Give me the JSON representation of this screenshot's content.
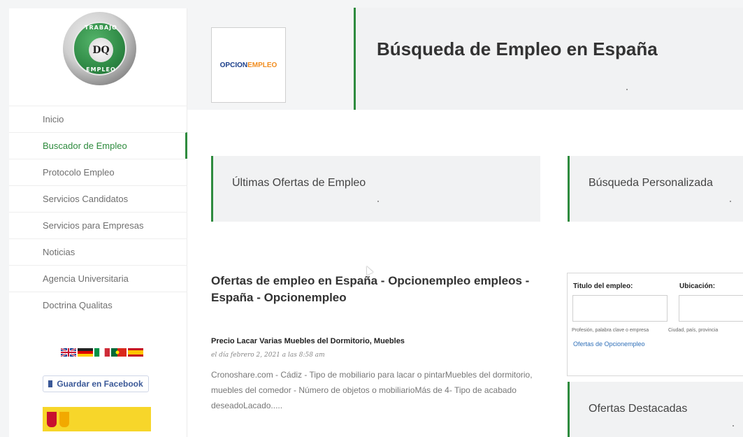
{
  "sidebar": {
    "logo": {
      "top_text": "TRABAJO",
      "center_text": "DQ",
      "bottom_text": "EMPLEO"
    },
    "items": [
      {
        "label": "Inicio"
      },
      {
        "label": "Buscador de Empleo"
      },
      {
        "label": "Protocolo Empleo"
      },
      {
        "label": "Servicios Candidatos"
      },
      {
        "label": "Servicios para Empresas"
      },
      {
        "label": "Noticias"
      },
      {
        "label": "Agencia Universitaria"
      },
      {
        "label": "Doctrina Qualitas"
      }
    ],
    "active_index": 1,
    "language_flags": [
      "uk-flag-icon",
      "germany-flag-icon",
      "italy-flag-icon",
      "portugal-flag-icon",
      "spain-flag-icon"
    ],
    "facebook_button": {
      "label": "Guardar en Facebook",
      "icon": "bookmark-icon"
    }
  },
  "header": {
    "brand_logo": {
      "part1": "OPCION",
      "part2": "EMPLEO"
    },
    "title": "Búsqueda de Empleo en España"
  },
  "sections": {
    "latest": {
      "title": "Últimas Ofertas de Empleo"
    },
    "custom_search": {
      "title": "Búsqueda Personalizada"
    },
    "featured": {
      "title": "Ofertas Destacadas"
    }
  },
  "listing": {
    "heading": "Ofertas de empleo en España - Opcionempleo empleos - España - Opcionempleo",
    "post": {
      "title": "Precio Lacar Varias Muebles del Dormitorio, Muebles",
      "date": "el día febrero 2, 2021 a las 8:58 am",
      "body": "Cronoshare.com - Cádiz - Tipo de mobiliario para lacar o pintarMuebles del dormitorio, muebles del comedor - Número de objetos o mobiliarioMás de 4- Tipo de acabado deseadoLacado....."
    }
  },
  "search_widget": {
    "job_label": "Titulo del empleo:",
    "location_label": "Ubicación:",
    "job_hint": "Profesión, palabra clave o empresa",
    "location_hint": "Ciudad, país, provincia",
    "link": "Ofertas de Opcionempleo"
  },
  "colors": {
    "accent": "#2e8b3e",
    "panel": "#f1f2f3",
    "facebook": "#3b5998",
    "brand_blue": "#1a3e8a",
    "brand_orange": "#f18d1f"
  }
}
